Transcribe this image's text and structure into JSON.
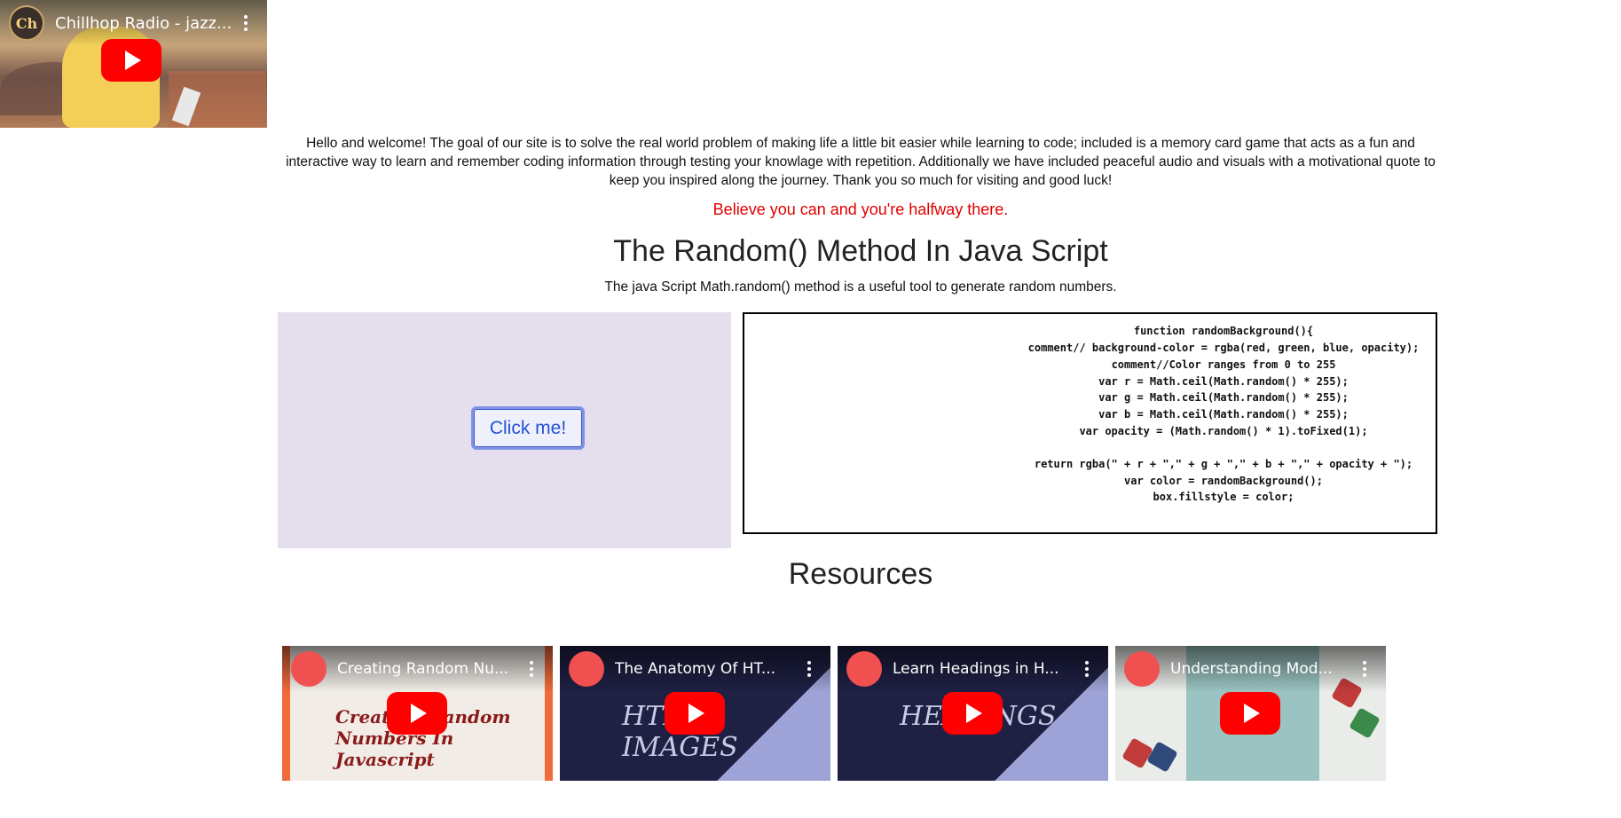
{
  "top_video": {
    "title": "Chillhop Radio - jazz...",
    "channel_avatar_text": "Ch"
  },
  "intro": {
    "text": "Hello and welcome! The goal of our site is to solve the real world problem of making life a little bit easier while learning to code; included is a memory card game that acts as a fun and interactive way to learn and remember coding information through testing your knowlage with repetition. Additionally we have included peaceful audio and visuals with a motivational quote to keep you inspired along the journey. Thank you so much for visiting and good luck!",
    "quote": "Believe you can and you're halfway there."
  },
  "random_section": {
    "title": "The Random() Method In Java Script",
    "subtitle": "The java Script Math.random() method is a useful tool to generate random numbers.",
    "button_label": "Click me!",
    "code_lines": [
      "function randomBackground(){",
      "comment// background-color = rgba(red, green, blue, opacity);",
      "comment//Color ranges from 0 to 255",
      "var r = Math.ceil(Math.random() * 255);",
      "var g = Math.ceil(Math.random() * 255);",
      "var b = Math.ceil(Math.random() * 255);",
      "var opacity = (Math.random() * 1).toFixed(1);",
      "",
      "return rgba(\" + r + \",\" + g + \",\" + b + \",\" + opacity + \");",
      "var color = randomBackground();",
      "box.fillstyle = color;"
    ]
  },
  "resources": {
    "title": "Resources",
    "videos": [
      {
        "title": "Creating Random Nu...",
        "thumb_text": "Creating Random Numbers In Javascript"
      },
      {
        "title": "The Anatomy Of HT...",
        "thumb_text": "HTML IMAGES"
      },
      {
        "title": "Learn Headings in H...",
        "thumb_text": "HEADINGS"
      },
      {
        "title": "Understanding Mod...",
        "thumb_text": ""
      }
    ]
  },
  "colors": {
    "quote": "#e10000",
    "demo_box_bg": "#e5deed",
    "button_text": "#2452d8",
    "play_button": "#ff0000"
  }
}
